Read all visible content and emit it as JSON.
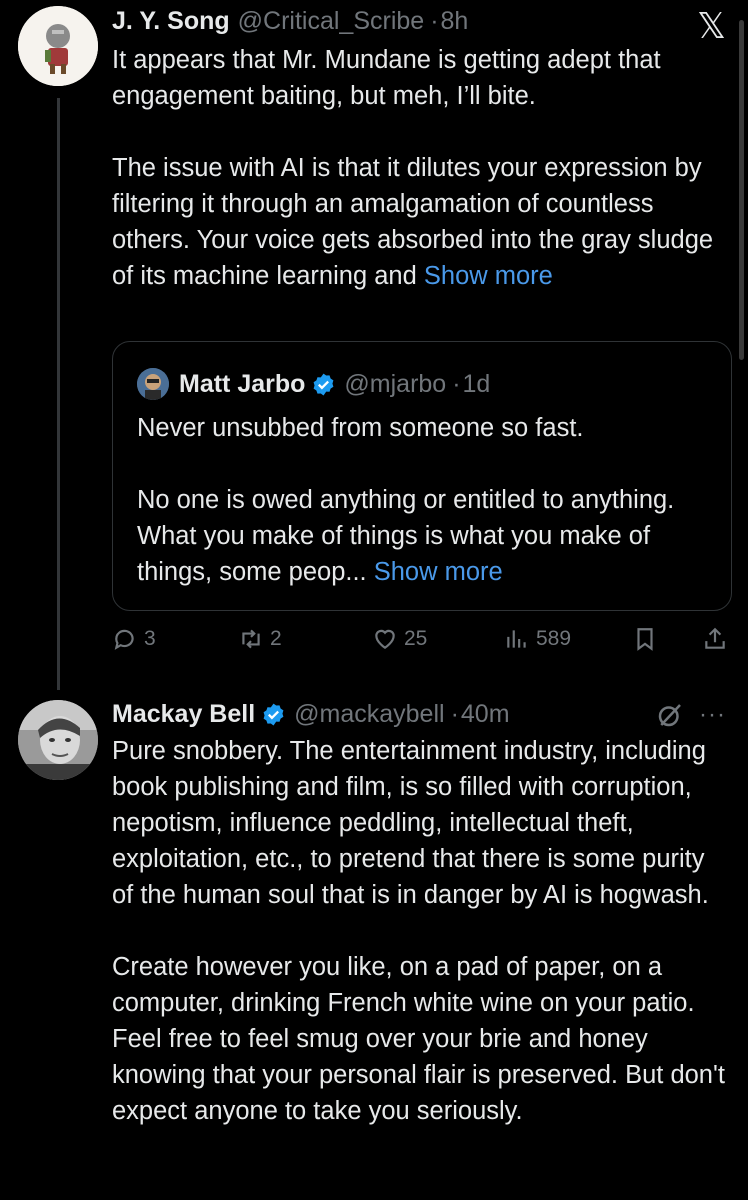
{
  "tweet1": {
    "name": "J. Y. Song",
    "handle": "@Critical_Scribe",
    "sep": "·",
    "time": "8h",
    "text": "It appears that Mr. Mundane is getting adept that engagement baiting, but meh, I’ll bite.\n\nThe issue with AI is that it dilutes your expression by filtering it through an amalgamation of countless others. Your voice gets absorbed into the gray sludge of its machine learning and",
    "show_more": "Show more",
    "quote": {
      "name": "Matt Jarbo",
      "handle": "@mjarbo",
      "sep": "·",
      "time": "1d",
      "text": "Never unsubbed from someone so fast.\n\nNo one is owed anything or entitled to anything. What you make of things is what you make of things, some peop...",
      "show_more": "Show more"
    },
    "actions": {
      "replies": "3",
      "reposts": "2",
      "likes": "25",
      "views": "589"
    }
  },
  "tweet2": {
    "name": "Mackay Bell",
    "handle": "@mackaybell",
    "sep": "·",
    "time": "40m",
    "more": "···",
    "text": "Pure snobbery. The entertainment industry, including book publishing and film, is so filled with corruption, nepotism, influence peddling, intellectual theft, exploitation, etc., to pretend that there is some purity of the human soul that is in danger by AI is hogwash.\n\nCreate however you like, on a pad of paper, on a computer, drinking French white wine on your patio. Feel free to feel smug over your brie and honey knowing that your personal flair is preserved. But don't expect anyone to take you seriously."
  },
  "icons": {
    "x_logo": "x-logo-icon",
    "verified": "verified-badge-icon",
    "reply": "reply-icon",
    "repost": "repost-icon",
    "like": "heart-icon",
    "views": "views-icon",
    "bookmark": "bookmark-icon",
    "share": "share-icon",
    "grok": "grok-icon"
  },
  "colors": {
    "background": "#000000",
    "text": "#e7e9ea",
    "muted": "#71767b",
    "link": "#4a99e9",
    "verified": "#1d9bf0"
  }
}
